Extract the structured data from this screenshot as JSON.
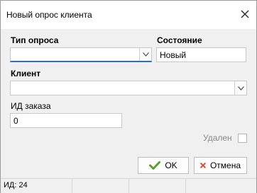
{
  "window": {
    "title": "Новый опрос клиента"
  },
  "form": {
    "survey_type_label": "Тип опроса",
    "survey_type_value": "",
    "state_label": "Состояние",
    "state_value": "Новый",
    "client_label": "Клиент",
    "client_value": "",
    "order_id_label": "ИД заказа",
    "order_id_value": "0",
    "deleted_label": "Удален",
    "deleted_checked": false
  },
  "buttons": {
    "ok_label": "OK",
    "cancel_label": "Отмена"
  },
  "status": {
    "id_text": "ИД: 24"
  },
  "colors": {
    "accent": "#2f6dbf",
    "ok_icon": "#5aa02c",
    "cancel_icon": "#e04a2c"
  }
}
